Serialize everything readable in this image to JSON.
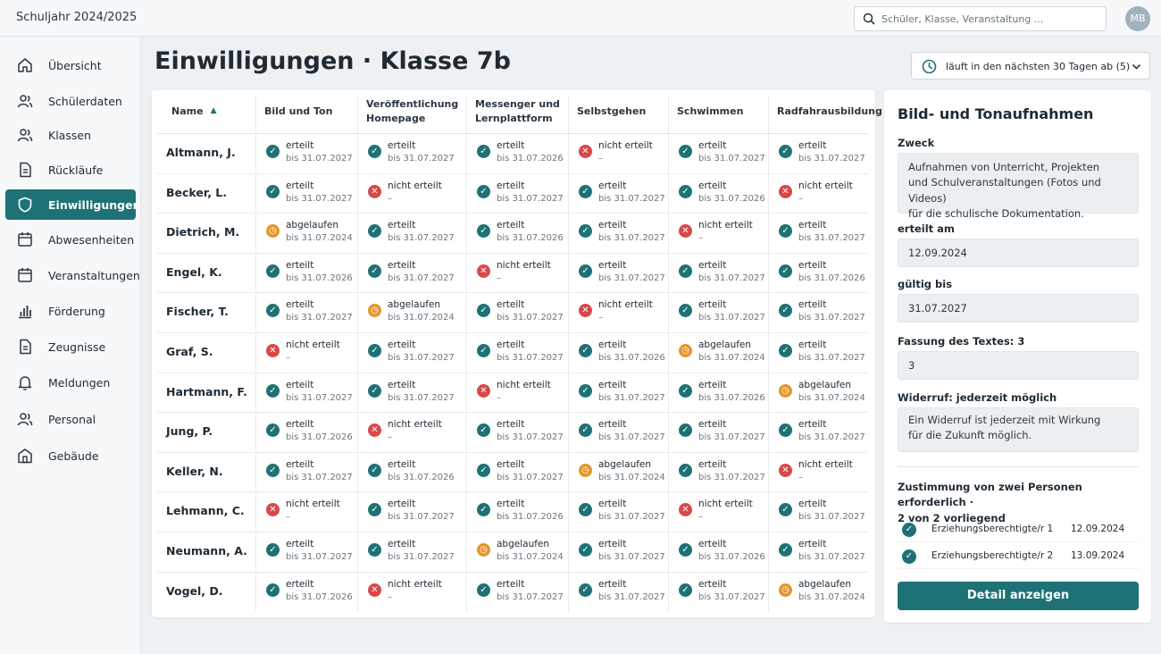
{
  "header": {
    "school_year": "Schuljahr 2024/2025",
    "search_placeholder": "Schüler, Klasse, Veranstaltung ...",
    "avatar_initials": "MB"
  },
  "sidebar": {
    "items": [
      {
        "label": "Übersicht",
        "icon": "home-icon",
        "active": false
      },
      {
        "label": "Schülerdaten",
        "icon": "users-icon",
        "active": false
      },
      {
        "label": "Klassen",
        "icon": "users-icon",
        "active": false
      },
      {
        "label": "Rückläufe",
        "icon": "document-icon",
        "active": false
      },
      {
        "label": "Einwilligungen",
        "icon": "shield-icon",
        "active": true
      },
      {
        "label": "Abwesenheiten",
        "icon": "calendar-icon",
        "active": false
      },
      {
        "label": "Veranstaltungen",
        "icon": "calendar-icon",
        "active": false
      },
      {
        "label": "Förderung",
        "icon": "bar-chart-icon",
        "active": false
      },
      {
        "label": "Zeugnisse",
        "icon": "document-icon",
        "active": false
      },
      {
        "label": "Meldungen",
        "icon": "bell-icon",
        "active": false
      },
      {
        "label": "Personal",
        "icon": "users-icon",
        "active": false
      },
      {
        "label": "Gebäude",
        "icon": "building-icon",
        "active": false
      }
    ]
  },
  "main": {
    "title": "Einwilligungen · Klasse 7b",
    "filter_label": "läuft in den nächsten 30 Tagen ab (5)"
  },
  "table": {
    "name_header": "Name",
    "columns": [
      "Bild und Ton",
      "Veröffentlichung\nHomepage",
      "Messenger und\nLernplattform",
      "Selbstgehen",
      "Schwimmen",
      "Radfahrausbildung"
    ],
    "rows": [
      {
        "name": "Altmann, J.",
        "cells": [
          {
            "status": "ok",
            "label": "erteilt",
            "sub": "bis 31.07.2027"
          },
          {
            "status": "ok",
            "label": "erteilt",
            "sub": "bis 31.07.2027"
          },
          {
            "status": "ok",
            "label": "erteilt",
            "sub": "bis 31.07.2026"
          },
          {
            "status": "no",
            "label": "nicht erteilt",
            "sub": "–"
          },
          {
            "status": "ok",
            "label": "erteilt",
            "sub": "bis 31.07.2027"
          },
          {
            "status": "ok",
            "label": "erteilt",
            "sub": "bis 31.07.2027"
          }
        ]
      },
      {
        "name": "Becker, L.",
        "cells": [
          {
            "status": "ok",
            "label": "erteilt",
            "sub": "bis 31.07.2027"
          },
          {
            "status": "no",
            "label": "nicht erteilt",
            "sub": "–"
          },
          {
            "status": "ok",
            "label": "erteilt",
            "sub": "bis 31.07.2027"
          },
          {
            "status": "ok",
            "label": "erteilt",
            "sub": "bis 31.07.2027"
          },
          {
            "status": "ok",
            "label": "erteilt",
            "sub": "bis 31.07.2026"
          },
          {
            "status": "no",
            "label": "nicht erteilt",
            "sub": "–"
          }
        ]
      },
      {
        "name": "Dietrich, M.",
        "cells": [
          {
            "status": "exp",
            "label": "abgelaufen",
            "sub": "bis 31.07.2024"
          },
          {
            "status": "ok",
            "label": "erteilt",
            "sub": "bis 31.07.2027"
          },
          {
            "status": "ok",
            "label": "erteilt",
            "sub": "bis 31.07.2026"
          },
          {
            "status": "ok",
            "label": "erteilt",
            "sub": "bis 31.07.2027"
          },
          {
            "status": "no",
            "label": "nicht erteilt",
            "sub": "–"
          },
          {
            "status": "ok",
            "label": "erteilt",
            "sub": "bis 31.07.2027"
          }
        ]
      },
      {
        "name": "Engel, K.",
        "cells": [
          {
            "status": "ok",
            "label": "erteilt",
            "sub": "bis 31.07.2026"
          },
          {
            "status": "ok",
            "label": "erteilt",
            "sub": "bis 31.07.2027"
          },
          {
            "status": "no",
            "label": "nicht erteilt",
            "sub": "–"
          },
          {
            "status": "ok",
            "label": "erteilt",
            "sub": "bis 31.07.2027"
          },
          {
            "status": "ok",
            "label": "erteilt",
            "sub": "bis 31.07.2027"
          },
          {
            "status": "ok",
            "label": "erteilt",
            "sub": "bis 31.07.2026"
          }
        ]
      },
      {
        "name": "Fischer, T.",
        "cells": [
          {
            "status": "ok",
            "label": "erteilt",
            "sub": "bis 31.07.2027"
          },
          {
            "status": "exp",
            "label": "abgelaufen",
            "sub": "bis 31.07.2024"
          },
          {
            "status": "ok",
            "label": "erteilt",
            "sub": "bis 31.07.2027"
          },
          {
            "status": "no",
            "label": "nicht erteilt",
            "sub": "–"
          },
          {
            "status": "ok",
            "label": "erteilt",
            "sub": "bis 31.07.2027"
          },
          {
            "status": "ok",
            "label": "erteilt",
            "sub": "bis 31.07.2027"
          }
        ]
      },
      {
        "name": "Graf, S.",
        "cells": [
          {
            "status": "no",
            "label": "nicht erteilt",
            "sub": "–"
          },
          {
            "status": "ok",
            "label": "erteilt",
            "sub": "bis 31.07.2027"
          },
          {
            "status": "ok",
            "label": "erteilt",
            "sub": "bis 31.07.2027"
          },
          {
            "status": "ok",
            "label": "erteilt",
            "sub": "bis 31.07.2026"
          },
          {
            "status": "exp",
            "label": "abgelaufen",
            "sub": "bis 31.07.2024"
          },
          {
            "status": "ok",
            "label": "erteilt",
            "sub": "bis 31.07.2027"
          }
        ]
      },
      {
        "name": "Hartmann, F.",
        "cells": [
          {
            "status": "ok",
            "label": "erteilt",
            "sub": "bis 31.07.2027"
          },
          {
            "status": "ok",
            "label": "erteilt",
            "sub": "bis 31.07.2027"
          },
          {
            "status": "no",
            "label": "nicht erteilt",
            "sub": "–"
          },
          {
            "status": "ok",
            "label": "erteilt",
            "sub": "bis 31.07.2027"
          },
          {
            "status": "ok",
            "label": "erteilt",
            "sub": "bis 31.07.2026"
          },
          {
            "status": "exp",
            "label": "abgelaufen",
            "sub": "bis 31.07.2024"
          }
        ]
      },
      {
        "name": "Jung, P.",
        "cells": [
          {
            "status": "ok",
            "label": "erteilt",
            "sub": "bis 31.07.2026"
          },
          {
            "status": "no",
            "label": "nicht erteilt",
            "sub": "–"
          },
          {
            "status": "ok",
            "label": "erteilt",
            "sub": "bis 31.07.2027"
          },
          {
            "status": "ok",
            "label": "erteilt",
            "sub": "bis 31.07.2027"
          },
          {
            "status": "ok",
            "label": "erteilt",
            "sub": "bis 31.07.2027"
          },
          {
            "status": "ok",
            "label": "erteilt",
            "sub": "bis 31.07.2027"
          }
        ]
      },
      {
        "name": "Keller, N.",
        "cells": [
          {
            "status": "ok",
            "label": "erteilt",
            "sub": "bis 31.07.2027"
          },
          {
            "status": "ok",
            "label": "erteilt",
            "sub": "bis 31.07.2026"
          },
          {
            "status": "ok",
            "label": "erteilt",
            "sub": "bis 31.07.2027"
          },
          {
            "status": "exp",
            "label": "abgelaufen",
            "sub": "bis 31.07.2024"
          },
          {
            "status": "ok",
            "label": "erteilt",
            "sub": "bis 31.07.2027"
          },
          {
            "status": "no",
            "label": "nicht erteilt",
            "sub": "–"
          }
        ]
      },
      {
        "name": "Lehmann, C.",
        "cells": [
          {
            "status": "no",
            "label": "nicht erteilt",
            "sub": "–"
          },
          {
            "status": "ok",
            "label": "erteilt",
            "sub": "bis 31.07.2027"
          },
          {
            "status": "ok",
            "label": "erteilt",
            "sub": "bis 31.07.2026"
          },
          {
            "status": "ok",
            "label": "erteilt",
            "sub": "bis 31.07.2027"
          },
          {
            "status": "no",
            "label": "nicht erteilt",
            "sub": "–"
          },
          {
            "status": "ok",
            "label": "erteilt",
            "sub": "bis 31.07.2027"
          }
        ]
      },
      {
        "name": "Neumann, A.",
        "cells": [
          {
            "status": "ok",
            "label": "erteilt",
            "sub": "bis 31.07.2027"
          },
          {
            "status": "ok",
            "label": "erteilt",
            "sub": "bis 31.07.2027"
          },
          {
            "status": "exp",
            "label": "abgelaufen",
            "sub": "bis 31.07.2024"
          },
          {
            "status": "ok",
            "label": "erteilt",
            "sub": "bis 31.07.2027"
          },
          {
            "status": "ok",
            "label": "erteilt",
            "sub": "bis 31.07.2026"
          },
          {
            "status": "ok",
            "label": "erteilt",
            "sub": "bis 31.07.2027"
          }
        ]
      },
      {
        "name": "Vogel, D.",
        "cells": [
          {
            "status": "ok",
            "label": "erteilt",
            "sub": "bis 31.07.2026"
          },
          {
            "status": "no",
            "label": "nicht erteilt",
            "sub": "–"
          },
          {
            "status": "ok",
            "label": "erteilt",
            "sub": "bis 31.07.2027"
          },
          {
            "status": "ok",
            "label": "erteilt",
            "sub": "bis 31.07.2027"
          },
          {
            "status": "ok",
            "label": "erteilt",
            "sub": "bis 31.07.2027"
          },
          {
            "status": "exp",
            "label": "abgelaufen",
            "sub": "bis 31.07.2024"
          }
        ]
      }
    ]
  },
  "detail": {
    "title": "Bild- und Tonaufnahmen",
    "purpose_label": "Zweck",
    "purpose_text": "Aufnahmen von Unterricht, Projekten\nund Schulveranstaltungen (Fotos und Videos)\nfür die schulische Dokumentation.",
    "granted_label": "erteilt am",
    "granted_value": "12.09.2024",
    "valid_label": "gültig bis",
    "valid_value": "31.07.2027",
    "version_label": "Fassung des Textes: 3",
    "version_value": "3",
    "revocation_label": "Widerruf: jederzeit möglich",
    "revocation_text": "Ein Widerruf ist jederzeit mit Wirkung\nfür die Zukunft möglich.",
    "consent_text": "Zustimmung von zwei Personen erforderlich ·\n2 von 2 vorliegend",
    "signatures": [
      {
        "who": "Erziehungsberechtigte/r 1",
        "date": "12.09.2024"
      },
      {
        "who": "Erziehungsberechtigte/r 2",
        "date": "13.09.2024"
      }
    ],
    "button_label": "Detail anzeigen"
  },
  "colors": {
    "accent": "#1e7275",
    "granted": "#1e7275",
    "denied": "#d84848",
    "expired": "#e4962a"
  }
}
